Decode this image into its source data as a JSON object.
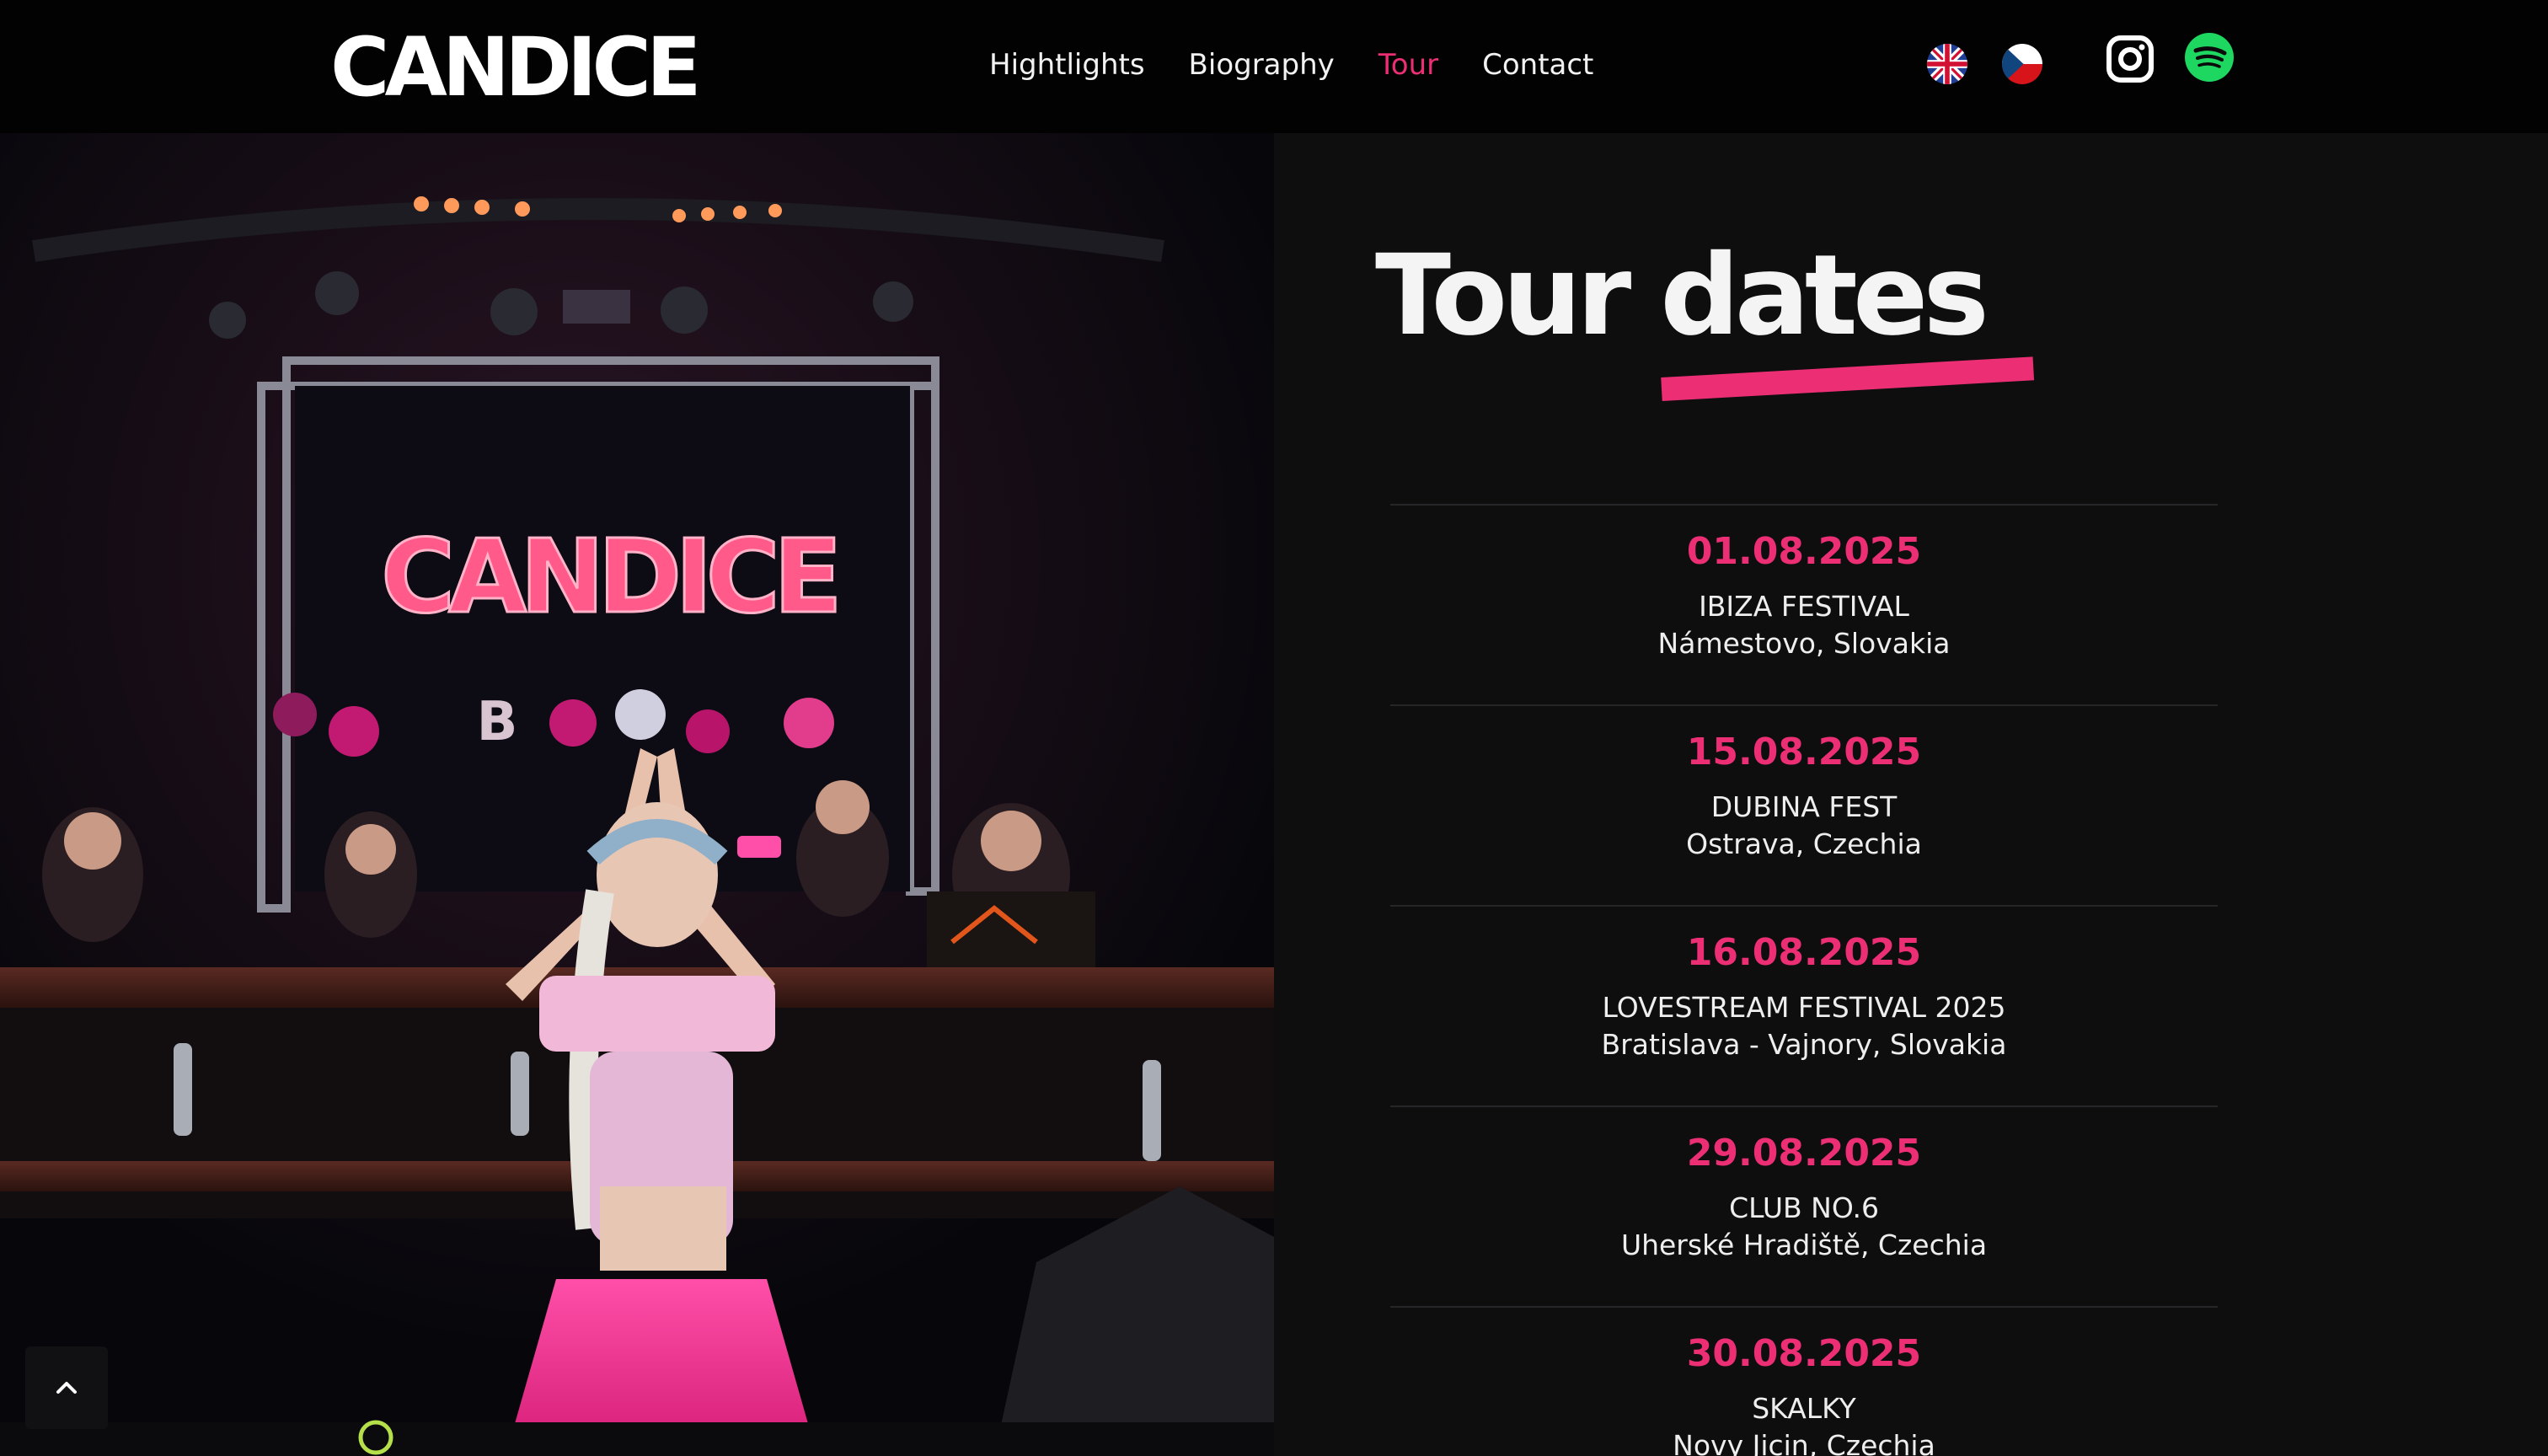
{
  "header": {
    "logo_text": "CANDICE",
    "nav": [
      {
        "label": "Hightlights",
        "active": false
      },
      {
        "label": "Biography",
        "active": false
      },
      {
        "label": "Tour",
        "active": true
      },
      {
        "label": "Contact",
        "active": false
      }
    ],
    "languages": [
      {
        "code": "en",
        "icon": "uk-flag-icon"
      },
      {
        "code": "cs",
        "icon": "czech-flag-icon"
      }
    ],
    "social": [
      {
        "name": "instagram",
        "icon": "instagram-icon",
        "color": "#ffffff"
      },
      {
        "name": "spotify",
        "icon": "spotify-icon",
        "color": "#1ed760"
      }
    ]
  },
  "hero": {
    "stage_sign_text": "CANDICE",
    "balloon_letter": "B"
  },
  "tour": {
    "title": "Tour dates",
    "accent_color": "#ec2f74",
    "dates": [
      {
        "date": "01.08.2025",
        "event": "IBIZA FESTIVAL",
        "place": "Námestovo, Slovakia"
      },
      {
        "date": "15.08.2025",
        "event": "DUBINA FEST",
        "place": "Ostrava, Czechia"
      },
      {
        "date": "16.08.2025",
        "event": "LOVESTREAM FESTIVAL 2025",
        "place": "Bratislava - Vajnory, Slovakia"
      },
      {
        "date": "29.08.2025",
        "event": "CLUB NO.6",
        "place": "Uherské Hradiště, Czechia"
      },
      {
        "date": "30.08.2025",
        "event": "SKALKY",
        "place": "Novy Jicin, Czechia"
      }
    ]
  },
  "scroll_top": {
    "icon": "chevron-up-icon"
  }
}
